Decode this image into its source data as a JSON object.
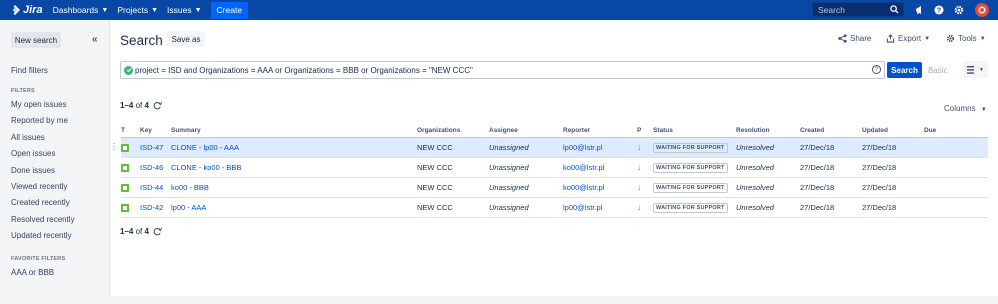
{
  "topbar": {
    "app_name": "Jira",
    "nav": [
      "Dashboards",
      "Projects",
      "Issues"
    ],
    "create_label": "Create",
    "search_placeholder": "Search",
    "colors": {
      "bar": "#0747a6",
      "create": "#0065ff"
    },
    "icons": [
      "search-icon",
      "megaphone-icon",
      "help-icon",
      "settings-icon",
      "user-avatar"
    ]
  },
  "sidebar": {
    "new_search_label": "New search",
    "collapse_icon": "double-chevron-left-icon",
    "find_filters_label": "Find filters",
    "filters_heading": "FILTERS",
    "filters": [
      "My open issues",
      "Reported by me",
      "All issues",
      "Open issues",
      "Done issues",
      "Viewed recently",
      "Created recently",
      "Resolved recently",
      "Updated recently"
    ],
    "favorite_heading": "FAVORITE FILTERS",
    "favorites": [
      "AAA or BBB"
    ]
  },
  "header": {
    "title": "Search",
    "save_as_label": "Save as",
    "share_label": "Share",
    "export_label": "Export",
    "tools_label": "Tools"
  },
  "query": {
    "jql": "project = ISD and Organizations = AAA or Organizations = BBB or Organizations = \"NEW CCC\"",
    "search_label": "Search",
    "basic_label": "Basic"
  },
  "results": {
    "range": "1–4",
    "of_label": "of",
    "total": "4",
    "columns_label": "Columns",
    "headers": [
      "T",
      "Key",
      "Summary",
      "Organizations",
      "Assignee",
      "Reporter",
      "P",
      "Status",
      "Resolution",
      "Created",
      "Updated",
      "Due"
    ],
    "rows": [
      {
        "key": "ISD-47",
        "summary": "CLONE - lp00 - AAA",
        "org": "NEW CCC",
        "assignee": "Unassigned",
        "reporter": "lp00@lstr.pl",
        "status": "WAITING FOR SUPPORT",
        "resolution": "Unresolved",
        "created": "27/Dec/18",
        "updated": "27/Dec/18",
        "due": ""
      },
      {
        "key": "ISD-46",
        "summary": "CLONE - ko00 - BBB",
        "org": "NEW CCC",
        "assignee": "Unassigned",
        "reporter": "ko00@lstr.pl",
        "status": "WAITING FOR SUPPORT",
        "resolution": "Unresolved",
        "created": "27/Dec/18",
        "updated": "27/Dec/18",
        "due": ""
      },
      {
        "key": "ISD-44",
        "summary": "ko00 - BBB",
        "org": "NEW CCC",
        "assignee": "Unassigned",
        "reporter": "ko00@lstr.pl",
        "status": "WAITING FOR SUPPORT",
        "resolution": "Unresolved",
        "created": "27/Dec/18",
        "updated": "27/Dec/18",
        "due": ""
      },
      {
        "key": "ISD-42",
        "summary": "lp00 - AAA",
        "org": "NEW CCC",
        "assignee": "Unassigned",
        "reporter": "lp00@lstr.pl",
        "status": "WAITING FOR SUPPORT",
        "resolution": "Unresolved",
        "created": "27/Dec/18",
        "updated": "27/Dec/18",
        "due": ""
      }
    ]
  }
}
